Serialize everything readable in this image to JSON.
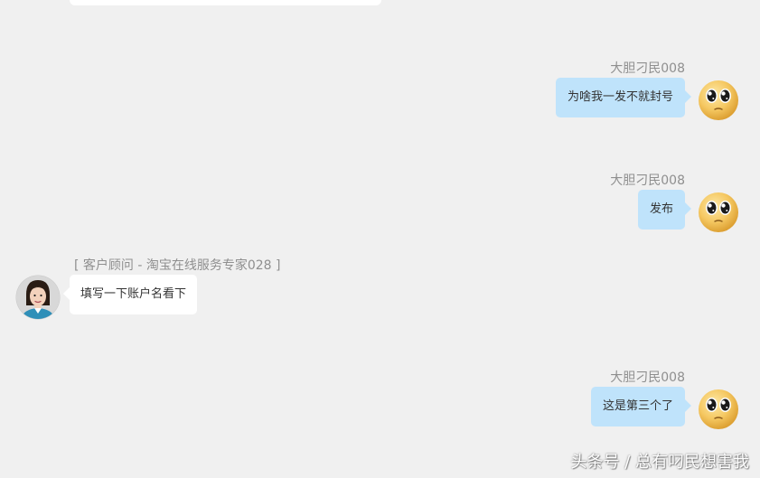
{
  "messages": [
    {
      "sender": "大胆刁民008",
      "text": "为啥我一发不就封号"
    },
    {
      "sender": "大胆刁民008",
      "text": "发布"
    },
    {
      "sender": "[ 客户顾问 - 淘宝在线服务专家028 ]",
      "text": "填写一下账户名看下"
    },
    {
      "sender": "大胆刁民008",
      "text": "这是第三个了"
    }
  ],
  "watermark": "头条号 / 总有叼民想害我",
  "colors": {
    "background": "#f0f0f0",
    "outgoing_bubble": "#bfe3fb",
    "incoming_bubble": "#ffffff",
    "sender_name": "#8f8f8f",
    "message_text": "#333333"
  },
  "icons": {
    "user_avatar": "crying-face-emoji-icon",
    "agent_avatar": "agent-portrait-icon"
  }
}
